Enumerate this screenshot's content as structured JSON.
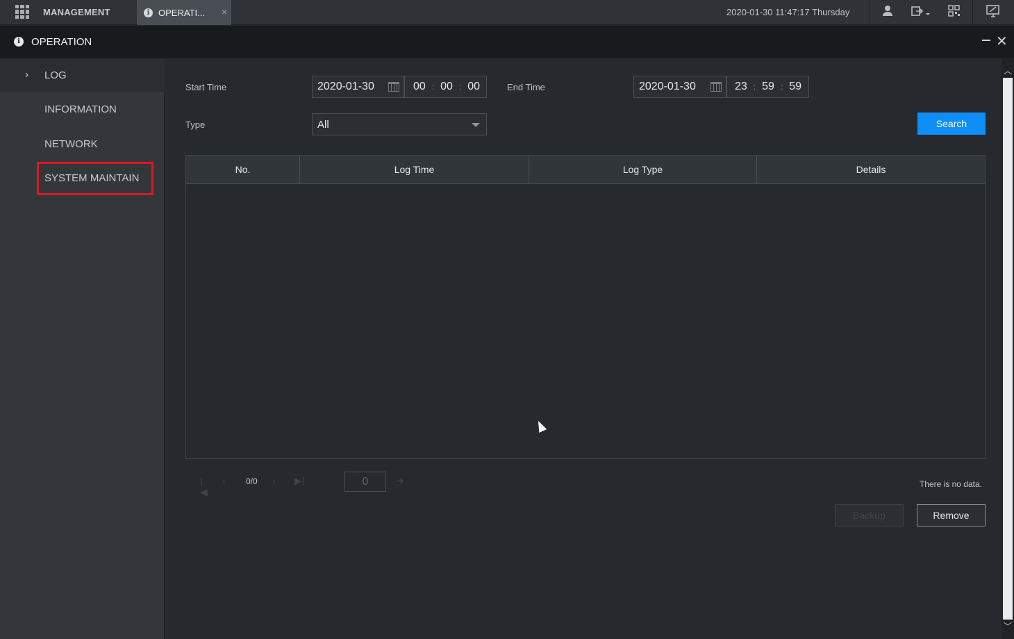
{
  "topbar": {
    "app_label": "MANAGEMENT",
    "tab_label": "OPERATI...",
    "tab_close": "×",
    "datetime": "2020-01-30 11:47:17 Thursday",
    "icons": [
      "grid-menu-icon",
      "info-icon",
      "user-icon",
      "logout-icon",
      "qr-icon",
      "monitor-icon"
    ]
  },
  "window": {
    "title": "OPERATION",
    "close": "✕"
  },
  "sidebar": {
    "items": [
      {
        "label": "LOG",
        "active": true
      },
      {
        "label": "INFORMATION"
      },
      {
        "label": "NETWORK"
      },
      {
        "label": "SYSTEM MAINTAIN",
        "highlighted": true
      }
    ],
    "chevron": "›"
  },
  "form": {
    "start_time_label": "Start Time",
    "start_date": "2020-01-30",
    "start_h": "00",
    "start_m": "00",
    "start_s": "00",
    "end_time_label": "End Time",
    "end_date": "2020-01-30",
    "end_h": "23",
    "end_m": "59",
    "end_s": "59",
    "type_label": "Type",
    "type_value": "All",
    "time_sep": ":",
    "search_label": "Search"
  },
  "table": {
    "columns": [
      "No.",
      "Log Time",
      "Log Type",
      "Details"
    ],
    "rows": []
  },
  "pager": {
    "count": "0/0",
    "page_input": "0",
    "no_data": "There is no data."
  },
  "actions": {
    "backup_label": "Backup",
    "remove_label": "Remove"
  },
  "colors": {
    "accent": "#0f8ef7",
    "highlight": "#e0161f"
  }
}
